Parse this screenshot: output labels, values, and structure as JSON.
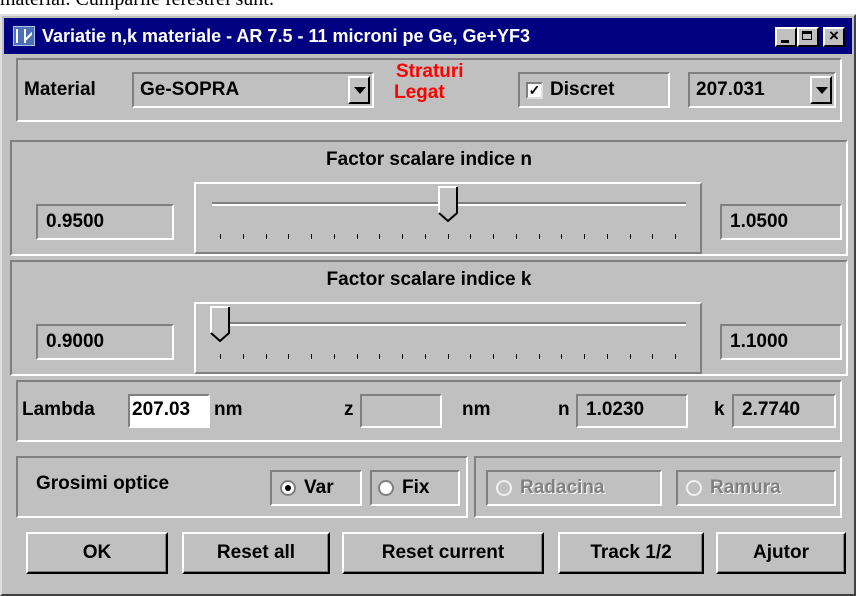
{
  "caption": "material. Cumparile ferestrei sunt:",
  "window": {
    "title": "Variatie n,k materiale - AR 7.5 - 11 microni pe Ge, Ge+YF3",
    "buttons": [
      "minimize",
      "maximize",
      "close"
    ]
  },
  "material_row": {
    "label": "Material",
    "material_value": "Ge-SOPRA",
    "strat_line1": "Straturi",
    "strat_line2": "Legat",
    "strat_color": "#ff0000",
    "discret_label": "Discret",
    "discret_checked": true,
    "check_mark": "✓",
    "lambda_select": "207.031"
  },
  "slider_n": {
    "title": "Factor scalare indice n",
    "min_value": "0.9500",
    "max_value": "1.0500",
    "position_fraction": 0.5,
    "tick_count": 21
  },
  "slider_k": {
    "title": "Factor scalare indice k",
    "min_value": "0.9000",
    "max_value": "1.1000",
    "position_fraction": 0.0,
    "tick_count": 21
  },
  "readout": {
    "lambda_label": "Lambda",
    "lambda_value": "207.03",
    "lambda_unit": "nm",
    "z_label": "z",
    "z_value": "",
    "z_unit": "nm",
    "n_label": "n",
    "n_value": "1.0230",
    "k_label": "k",
    "k_value": "2.7740"
  },
  "optics": {
    "label": "Grosimi optice",
    "var_label": "Var",
    "fix_label": "Fix",
    "selected": "Var",
    "radacina_label": "Radacina",
    "ramura_label": "Ramura"
  },
  "actions": {
    "ok": "OK",
    "reset_all": "Reset all",
    "reset_current": "Reset current",
    "track": "Track 1/2",
    "help": "Ajutor"
  }
}
